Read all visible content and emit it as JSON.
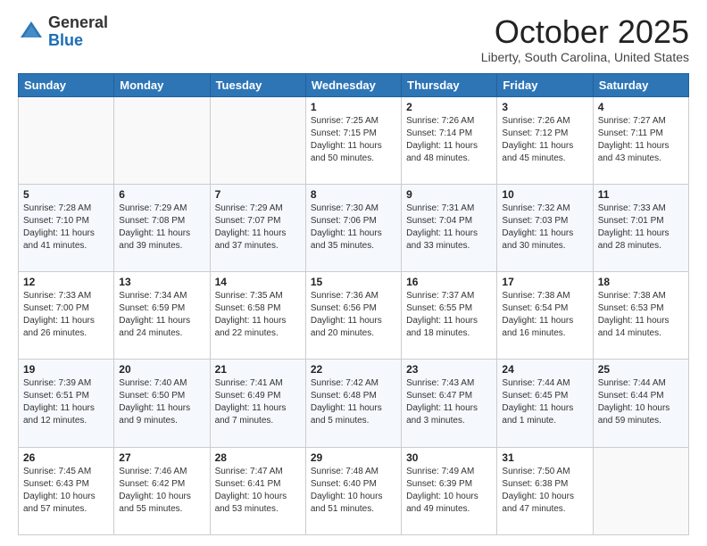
{
  "header": {
    "logo_general": "General",
    "logo_blue": "Blue",
    "month": "October 2025",
    "location": "Liberty, South Carolina, United States"
  },
  "days_of_week": [
    "Sunday",
    "Monday",
    "Tuesday",
    "Wednesday",
    "Thursday",
    "Friday",
    "Saturday"
  ],
  "weeks": [
    [
      {
        "day": "",
        "sunrise": "",
        "sunset": "",
        "daylight": ""
      },
      {
        "day": "",
        "sunrise": "",
        "sunset": "",
        "daylight": ""
      },
      {
        "day": "",
        "sunrise": "",
        "sunset": "",
        "daylight": ""
      },
      {
        "day": "1",
        "sunrise": "Sunrise: 7:25 AM",
        "sunset": "Sunset: 7:15 PM",
        "daylight": "Daylight: 11 hours and 50 minutes."
      },
      {
        "day": "2",
        "sunrise": "Sunrise: 7:26 AM",
        "sunset": "Sunset: 7:14 PM",
        "daylight": "Daylight: 11 hours and 48 minutes."
      },
      {
        "day": "3",
        "sunrise": "Sunrise: 7:26 AM",
        "sunset": "Sunset: 7:12 PM",
        "daylight": "Daylight: 11 hours and 45 minutes."
      },
      {
        "day": "4",
        "sunrise": "Sunrise: 7:27 AM",
        "sunset": "Sunset: 7:11 PM",
        "daylight": "Daylight: 11 hours and 43 minutes."
      }
    ],
    [
      {
        "day": "5",
        "sunrise": "Sunrise: 7:28 AM",
        "sunset": "Sunset: 7:10 PM",
        "daylight": "Daylight: 11 hours and 41 minutes."
      },
      {
        "day": "6",
        "sunrise": "Sunrise: 7:29 AM",
        "sunset": "Sunset: 7:08 PM",
        "daylight": "Daylight: 11 hours and 39 minutes."
      },
      {
        "day": "7",
        "sunrise": "Sunrise: 7:29 AM",
        "sunset": "Sunset: 7:07 PM",
        "daylight": "Daylight: 11 hours and 37 minutes."
      },
      {
        "day": "8",
        "sunrise": "Sunrise: 7:30 AM",
        "sunset": "Sunset: 7:06 PM",
        "daylight": "Daylight: 11 hours and 35 minutes."
      },
      {
        "day": "9",
        "sunrise": "Sunrise: 7:31 AM",
        "sunset": "Sunset: 7:04 PM",
        "daylight": "Daylight: 11 hours and 33 minutes."
      },
      {
        "day": "10",
        "sunrise": "Sunrise: 7:32 AM",
        "sunset": "Sunset: 7:03 PM",
        "daylight": "Daylight: 11 hours and 30 minutes."
      },
      {
        "day": "11",
        "sunrise": "Sunrise: 7:33 AM",
        "sunset": "Sunset: 7:01 PM",
        "daylight": "Daylight: 11 hours and 28 minutes."
      }
    ],
    [
      {
        "day": "12",
        "sunrise": "Sunrise: 7:33 AM",
        "sunset": "Sunset: 7:00 PM",
        "daylight": "Daylight: 11 hours and 26 minutes."
      },
      {
        "day": "13",
        "sunrise": "Sunrise: 7:34 AM",
        "sunset": "Sunset: 6:59 PM",
        "daylight": "Daylight: 11 hours and 24 minutes."
      },
      {
        "day": "14",
        "sunrise": "Sunrise: 7:35 AM",
        "sunset": "Sunset: 6:58 PM",
        "daylight": "Daylight: 11 hours and 22 minutes."
      },
      {
        "day": "15",
        "sunrise": "Sunrise: 7:36 AM",
        "sunset": "Sunset: 6:56 PM",
        "daylight": "Daylight: 11 hours and 20 minutes."
      },
      {
        "day": "16",
        "sunrise": "Sunrise: 7:37 AM",
        "sunset": "Sunset: 6:55 PM",
        "daylight": "Daylight: 11 hours and 18 minutes."
      },
      {
        "day": "17",
        "sunrise": "Sunrise: 7:38 AM",
        "sunset": "Sunset: 6:54 PM",
        "daylight": "Daylight: 11 hours and 16 minutes."
      },
      {
        "day": "18",
        "sunrise": "Sunrise: 7:38 AM",
        "sunset": "Sunset: 6:53 PM",
        "daylight": "Daylight: 11 hours and 14 minutes."
      }
    ],
    [
      {
        "day": "19",
        "sunrise": "Sunrise: 7:39 AM",
        "sunset": "Sunset: 6:51 PM",
        "daylight": "Daylight: 11 hours and 12 minutes."
      },
      {
        "day": "20",
        "sunrise": "Sunrise: 7:40 AM",
        "sunset": "Sunset: 6:50 PM",
        "daylight": "Daylight: 11 hours and 9 minutes."
      },
      {
        "day": "21",
        "sunrise": "Sunrise: 7:41 AM",
        "sunset": "Sunset: 6:49 PM",
        "daylight": "Daylight: 11 hours and 7 minutes."
      },
      {
        "day": "22",
        "sunrise": "Sunrise: 7:42 AM",
        "sunset": "Sunset: 6:48 PM",
        "daylight": "Daylight: 11 hours and 5 minutes."
      },
      {
        "day": "23",
        "sunrise": "Sunrise: 7:43 AM",
        "sunset": "Sunset: 6:47 PM",
        "daylight": "Daylight: 11 hours and 3 minutes."
      },
      {
        "day": "24",
        "sunrise": "Sunrise: 7:44 AM",
        "sunset": "Sunset: 6:45 PM",
        "daylight": "Daylight: 11 hours and 1 minute."
      },
      {
        "day": "25",
        "sunrise": "Sunrise: 7:44 AM",
        "sunset": "Sunset: 6:44 PM",
        "daylight": "Daylight: 10 hours and 59 minutes."
      }
    ],
    [
      {
        "day": "26",
        "sunrise": "Sunrise: 7:45 AM",
        "sunset": "Sunset: 6:43 PM",
        "daylight": "Daylight: 10 hours and 57 minutes."
      },
      {
        "day": "27",
        "sunrise": "Sunrise: 7:46 AM",
        "sunset": "Sunset: 6:42 PM",
        "daylight": "Daylight: 10 hours and 55 minutes."
      },
      {
        "day": "28",
        "sunrise": "Sunrise: 7:47 AM",
        "sunset": "Sunset: 6:41 PM",
        "daylight": "Daylight: 10 hours and 53 minutes."
      },
      {
        "day": "29",
        "sunrise": "Sunrise: 7:48 AM",
        "sunset": "Sunset: 6:40 PM",
        "daylight": "Daylight: 10 hours and 51 minutes."
      },
      {
        "day": "30",
        "sunrise": "Sunrise: 7:49 AM",
        "sunset": "Sunset: 6:39 PM",
        "daylight": "Daylight: 10 hours and 49 minutes."
      },
      {
        "day": "31",
        "sunrise": "Sunrise: 7:50 AM",
        "sunset": "Sunset: 6:38 PM",
        "daylight": "Daylight: 10 hours and 47 minutes."
      },
      {
        "day": "",
        "sunrise": "",
        "sunset": "",
        "daylight": ""
      }
    ]
  ]
}
